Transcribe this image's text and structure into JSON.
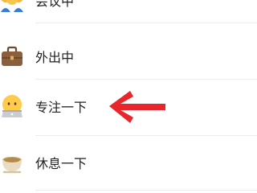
{
  "status_list": {
    "items": [
      {
        "label": "会议中",
        "icon": "meeting-people-icon"
      },
      {
        "label": "外出中",
        "icon": "briefcase-icon"
      },
      {
        "label": "专注一下",
        "icon": "focus-face-laptop-icon"
      },
      {
        "label": "休息一下",
        "icon": "tea-cup-icon"
      }
    ]
  },
  "annotation": {
    "icon": "red-arrow-icon",
    "color": "#e8262c"
  },
  "colors": {
    "text": "#222222",
    "divider": "#ececec",
    "background": "#ffffff"
  }
}
